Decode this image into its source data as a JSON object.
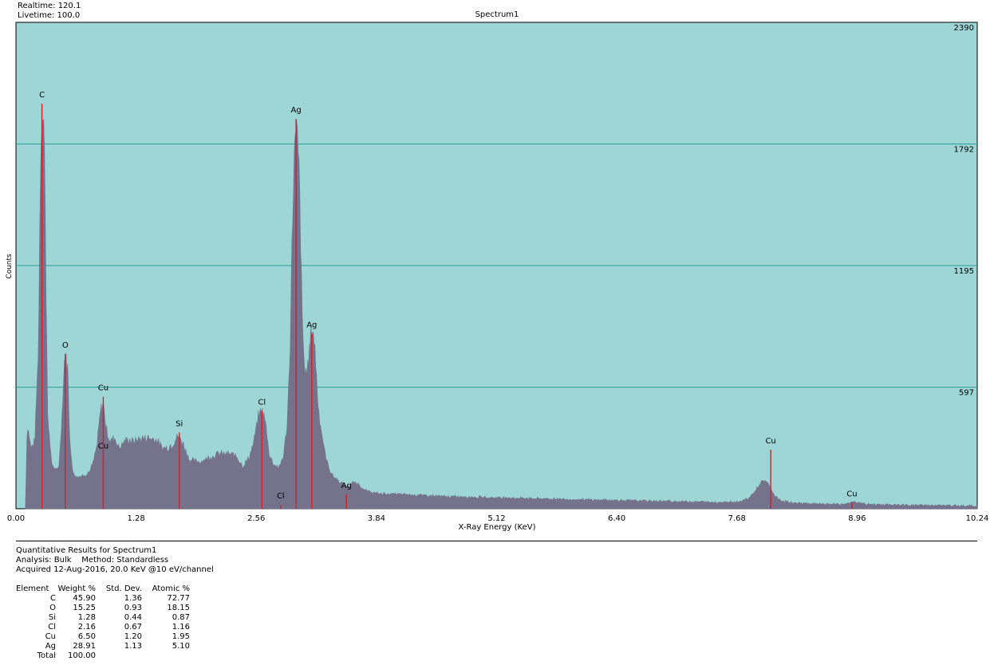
{
  "meta": {
    "realtime": "Realtime: 120.1",
    "livetime": "Livetime: 100.0"
  },
  "colors": {
    "plot_bg": "#9ed5d5",
    "spectrum": "#75738c",
    "peak_marker": "#d4202a",
    "gridline": "#2a9a9a"
  },
  "chart_data": {
    "type": "area",
    "title": "Spectrum1",
    "xlabel": "X-Ray Energy (KeV)",
    "ylabel": "Counts",
    "xlim": [
      0,
      10.24
    ],
    "ylim": [
      0,
      2390
    ],
    "x_ticks": [
      "0.00",
      "1.28",
      "2.56",
      "3.84",
      "5.12",
      "6.40",
      "7.68",
      "8.96",
      "10.24"
    ],
    "y_ticks": [
      "597",
      "1195",
      "1792",
      "2390"
    ],
    "grid": "horizontal",
    "profile": [
      [
        0.1,
        0
      ],
      [
        0.12,
        420
      ],
      [
        0.16,
        300
      ],
      [
        0.2,
        330
      ],
      [
        0.24,
        800
      ],
      [
        0.26,
        1700
      ],
      [
        0.28,
        2000
      ],
      [
        0.3,
        1900
      ],
      [
        0.32,
        1100
      ],
      [
        0.34,
        420
      ],
      [
        0.38,
        230
      ],
      [
        0.42,
        180
      ],
      [
        0.46,
        220
      ],
      [
        0.49,
        460
      ],
      [
        0.52,
        760
      ],
      [
        0.55,
        700
      ],
      [
        0.57,
        380
      ],
      [
        0.6,
        190
      ],
      [
        0.64,
        160
      ],
      [
        0.7,
        160
      ],
      [
        0.78,
        180
      ],
      [
        0.82,
        220
      ],
      [
        0.86,
        300
      ],
      [
        0.9,
        480
      ],
      [
        0.93,
        520
      ],
      [
        0.96,
        400
      ],
      [
        1.0,
        330
      ],
      [
        1.05,
        350
      ],
      [
        1.1,
        300
      ],
      [
        1.15,
        330
      ],
      [
        1.2,
        340
      ],
      [
        1.25,
        330
      ],
      [
        1.3,
        340
      ],
      [
        1.4,
        350
      ],
      [
        1.5,
        340
      ],
      [
        1.55,
        300
      ],
      [
        1.62,
        300
      ],
      [
        1.67,
        320
      ],
      [
        1.73,
        360
      ],
      [
        1.78,
        320
      ],
      [
        1.85,
        240
      ],
      [
        1.95,
        230
      ],
      [
        2.05,
        250
      ],
      [
        2.15,
        270
      ],
      [
        2.25,
        270
      ],
      [
        2.35,
        260
      ],
      [
        2.42,
        210
      ],
      [
        2.48,
        250
      ],
      [
        2.53,
        320
      ],
      [
        2.58,
        450
      ],
      [
        2.62,
        490
      ],
      [
        2.66,
        420
      ],
      [
        2.7,
        260
      ],
      [
        2.75,
        220
      ],
      [
        2.8,
        200
      ],
      [
        2.85,
        260
      ],
      [
        2.89,
        420
      ],
      [
        2.92,
        800
      ],
      [
        2.94,
        1300
      ],
      [
        2.96,
        1700
      ],
      [
        2.985,
        1840
      ],
      [
        3.0,
        1800
      ],
      [
        3.02,
        1600
      ],
      [
        3.05,
        900
      ],
      [
        3.08,
        650
      ],
      [
        3.11,
        700
      ],
      [
        3.14,
        850
      ],
      [
        3.16,
        890
      ],
      [
        3.18,
        820
      ],
      [
        3.22,
        500
      ],
      [
        3.26,
        360
      ],
      [
        3.3,
        250
      ],
      [
        3.35,
        180
      ],
      [
        3.4,
        150
      ],
      [
        3.48,
        120
      ],
      [
        3.55,
        110
      ],
      [
        3.6,
        130
      ],
      [
        3.65,
        120
      ],
      [
        3.72,
        90
      ],
      [
        3.84,
        75
      ],
      [
        4.2,
        70
      ],
      [
        4.6,
        60
      ],
      [
        5.12,
        55
      ],
      [
        5.6,
        50
      ],
      [
        6.0,
        45
      ],
      [
        6.4,
        42
      ],
      [
        6.8,
        38
      ],
      [
        7.2,
        35
      ],
      [
        7.5,
        32
      ],
      [
        7.7,
        35
      ],
      [
        7.8,
        50
      ],
      [
        7.88,
        90
      ],
      [
        7.94,
        130
      ],
      [
        7.98,
        135
      ],
      [
        8.02,
        120
      ],
      [
        8.06,
        80
      ],
      [
        8.12,
        45
      ],
      [
        8.25,
        30
      ],
      [
        8.6,
        22
      ],
      [
        8.8,
        22
      ],
      [
        8.88,
        28
      ],
      [
        8.92,
        33
      ],
      [
        8.98,
        30
      ],
      [
        9.05,
        22
      ],
      [
        9.5,
        18
      ],
      [
        10.0,
        15
      ],
      [
        10.24,
        14
      ]
    ],
    "markers": [
      {
        "label": "C",
        "x": 0.277,
        "y": 1990
      },
      {
        "label": "O",
        "x": 0.525,
        "y": 760
      },
      {
        "label": "Cu",
        "x": 0.93,
        "y": 550
      },
      {
        "label": "Cu",
        "x": 0.93,
        "y": 265
      },
      {
        "label": "Si",
        "x": 1.74,
        "y": 375
      },
      {
        "label": "Cl",
        "x": 2.62,
        "y": 480
      },
      {
        "label": "Cl",
        "x": 2.82,
        "y": 20
      },
      {
        "label": "Ag",
        "x": 2.984,
        "y": 1915
      },
      {
        "label": "Ag",
        "x": 3.151,
        "y": 860
      },
      {
        "label": "Ag",
        "x": 3.52,
        "y": 70
      },
      {
        "label": "Cu",
        "x": 8.04,
        "y": 290
      },
      {
        "label": "Cu",
        "x": 8.905,
        "y": 30
      }
    ]
  },
  "results": {
    "heading": "Quantitative Results for Spectrum1",
    "analysis": "Analysis: Bulk    Method: Standardless",
    "acquired": "Acquired 12-Aug-2016, 20.0 KeV @10 eV/channel",
    "columns": [
      "Element",
      "Weight %",
      "Std. Dev.",
      "Atomic %"
    ],
    "rows": [
      [
        "C",
        "45.90",
        "1.36",
        "72.77"
      ],
      [
        "O",
        "15.25",
        "0.93",
        "18.15"
      ],
      [
        "Si",
        "1.28",
        "0.44",
        "0.87"
      ],
      [
        "Cl",
        "2.16",
        "0.67",
        "1.16"
      ],
      [
        "Cu",
        "6.50",
        "1.20",
        "1.95"
      ],
      [
        "Ag",
        "28.91",
        "1.13",
        "5.10"
      ],
      [
        "Total",
        "100.00",
        "",
        ""
      ]
    ]
  }
}
